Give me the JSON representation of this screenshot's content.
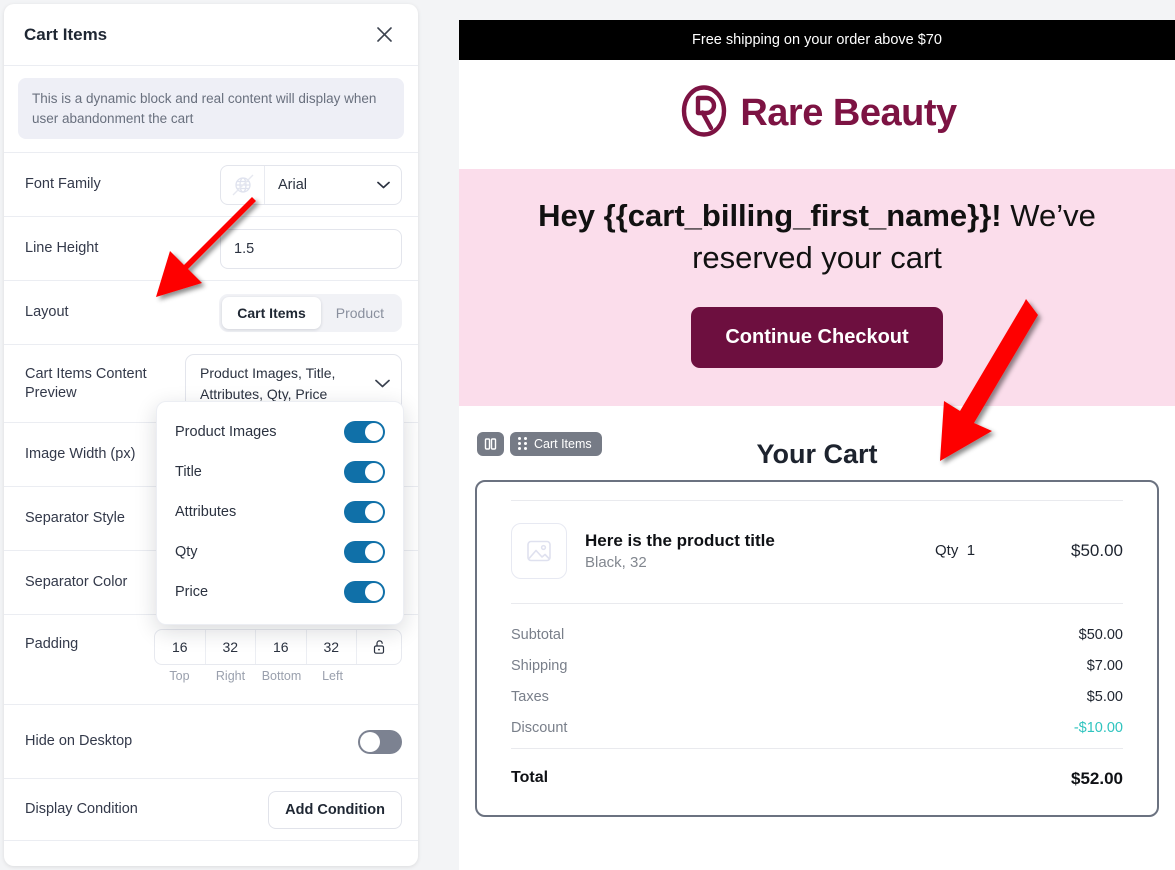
{
  "settings": {
    "title": "Cart Items",
    "close_icon": "close-icon",
    "info_text": "This is a dynamic block and real content will display when user abandonment the cart",
    "rows": {
      "font_family": {
        "label": "Font Family",
        "value": "Arial",
        "icon": "globe-slash-icon"
      },
      "line_height": {
        "label": "Line Height",
        "value": "1.5"
      },
      "layout": {
        "label": "Layout",
        "options": [
          "Cart Items",
          "Product"
        ],
        "selected": "Cart Items"
      },
      "content_preview": {
        "label": "Cart Items Content Preview",
        "value": "Product Images, Title, Attributes, Qty, Price"
      },
      "image_width": {
        "label": "Image Width (px)"
      },
      "separator_style": {
        "label": "Separator Style"
      },
      "separator_color": {
        "label": "Separator Color"
      },
      "padding": {
        "label": "Padding",
        "values": [
          "16",
          "32",
          "16",
          "32"
        ],
        "sides": [
          "Top",
          "Right",
          "Bottom",
          "Left"
        ],
        "lock_icon": "unlock-icon"
      },
      "hide_on_desktop": {
        "label": "Hide on Desktop",
        "enabled": false
      },
      "display_condition": {
        "label": "Display Condition",
        "button": "Add Condition"
      }
    },
    "dropdown": {
      "items": [
        {
          "label": "Product Images",
          "enabled": true
        },
        {
          "label": "Title",
          "enabled": true
        },
        {
          "label": "Attributes",
          "enabled": true
        },
        {
          "label": "Qty",
          "enabled": true
        },
        {
          "label": "Price",
          "enabled": true
        }
      ]
    }
  },
  "preview": {
    "shipping_bar": "Free shipping on your order above $70",
    "brand": {
      "name": "Rare Beauty",
      "logo_icon": "rare-beauty-logo-icon",
      "color": "#7d1343"
    },
    "hero": {
      "heading_bold": "Hey {{cart_billing_first_name}}!",
      "heading_rest": " We’ve reserved your cart",
      "cta_label": "Continue Checkout",
      "bg_color": "#fbddeb",
      "cta_color": "#6d0f3f"
    },
    "cart": {
      "block_badge": "Cart Items",
      "columns_icon": "columns-icon",
      "drag_icon": "drag-handle-icon",
      "heading": "Your Cart",
      "item": {
        "image_icon": "image-placeholder-icon",
        "title": "Here is the product title",
        "attributes": "Black, 32",
        "qty_label": "Qty",
        "qty_value": "1",
        "price": "$50.00"
      },
      "totals": [
        {
          "label": "Subtotal",
          "value": "$50.00",
          "accent": false
        },
        {
          "label": "Shipping",
          "value": "$7.00",
          "accent": false
        },
        {
          "label": "Taxes",
          "value": "$5.00",
          "accent": false
        },
        {
          "label": "Discount",
          "value": "-$10.00",
          "accent": true
        }
      ],
      "grand_total": {
        "label": "Total",
        "value": "$52.00"
      },
      "discount_color": "#2fc4bf"
    }
  },
  "annotations": {
    "arrow_color": "#fe0000",
    "arrow_left": "points-to-layout-row",
    "arrow_right": "points-to-cart-items-block"
  }
}
